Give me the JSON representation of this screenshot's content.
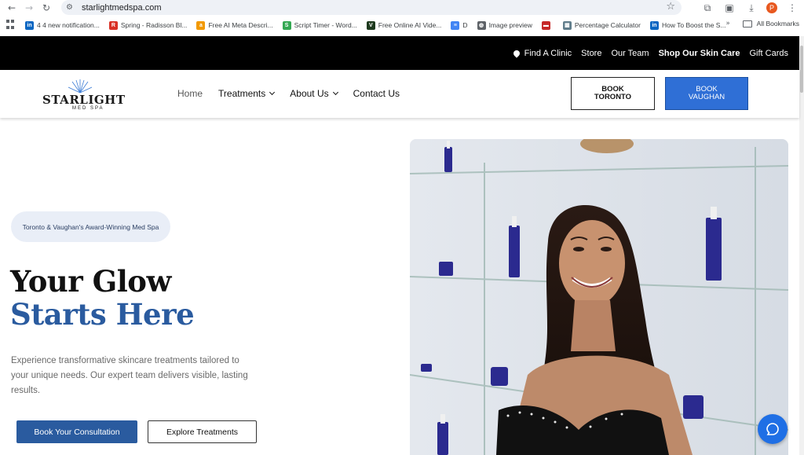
{
  "browser": {
    "url": "starlightmedspa.com",
    "profile_initial": "P",
    "bookmarks": [
      {
        "label": "4 4 new notification...",
        "color": "#0a66c2",
        "glyph": "in"
      },
      {
        "label": "Spring - Radisson Bl...",
        "color": "#d93025",
        "glyph": "R"
      },
      {
        "label": "Free AI Meta Descri...",
        "color": "#f29900",
        "glyph": "a"
      },
      {
        "label": "Script Timer - Word...",
        "color": "#34a853",
        "glyph": "S"
      },
      {
        "label": "Free Online AI Vide...",
        "color": "#1e3a1e",
        "glyph": "V"
      },
      {
        "label": "D",
        "color": "#4285f4",
        "glyph": "≡"
      },
      {
        "label": "Image preview",
        "color": "#5f6368",
        "glyph": "◍"
      },
      {
        "label": "",
        "color": "#c62828",
        "glyph": "▬"
      },
      {
        "label": "Percentage Calculator",
        "color": "#607d8b",
        "glyph": "▦"
      },
      {
        "label": "How To Boost the S...",
        "color": "#0a66c2",
        "glyph": "in"
      }
    ],
    "all_bookmarks": "All Bookmarks"
  },
  "topbar": {
    "find_clinic": "Find A Clinic",
    "store": "Store",
    "our_team": "Our Team",
    "shop": "Shop Our Skin Care",
    "gift_cards": "Gift Cards"
  },
  "nav": {
    "logo_word": "STARLIGHT",
    "logo_sub": "MED SPA",
    "home": "Home",
    "treatments": "Treatments",
    "about": "About Us",
    "contact": "Contact Us",
    "book_toronto_1": "BOOK",
    "book_toronto_2": "TORONTO",
    "book_vaughan_1": "BOOK",
    "book_vaughan_2": "VAUGHAN"
  },
  "hero": {
    "badge": "Toronto & Vaughan's Award-Winning Med Spa",
    "headline_1": "Your Glow",
    "headline_2": "Starts Here",
    "description": "Experience transformative skincare treatments tailored to your unique needs. Our expert team delivers visible, lasting results.",
    "cta_primary": "Book Your Consultation",
    "cta_secondary": "Explore Treatments"
  },
  "colors": {
    "accent_blue": "#2a5b9f",
    "book_vaughan_blue": "#2f6fd6",
    "chat_blue": "#1f6fe5"
  }
}
